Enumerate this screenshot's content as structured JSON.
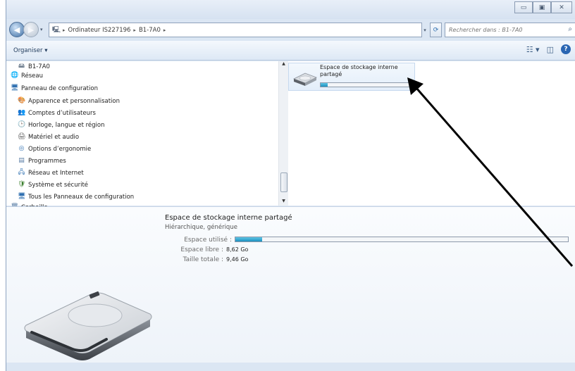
{
  "window": {
    "controls": {
      "minimize": "▭",
      "maximize": "▣",
      "close": "✕"
    }
  },
  "address": {
    "crumbs": [
      "Ordinateur IS227196",
      "B1-7A0"
    ],
    "separator": "▸",
    "refresh_icon": "⟳",
    "search_placeholder": "Rechercher dans : B1-7A0",
    "search_icon": "⌕"
  },
  "toolbar": {
    "organiser_label": "Organiser ▾",
    "view_icon": "☷ ▾",
    "preview_icon": "◫",
    "help_icon": "?"
  },
  "navigation": {
    "items": [
      {
        "label": "B1-7A0",
        "icon": "drive-icon",
        "glyph": "🖴"
      },
      {
        "label": "Réseau",
        "icon": "network-icon",
        "glyph": "🌐"
      },
      {
        "label": "Panneau de configuration",
        "icon": "control-panel-icon",
        "glyph": "🖥"
      },
      {
        "label": "Apparence et personnalisation",
        "icon": "appearance-icon",
        "glyph": "🎨"
      },
      {
        "label": "Comptes d’utilisateurs",
        "icon": "users-icon",
        "glyph": "👥"
      },
      {
        "label": "Horloge, langue et région",
        "icon": "clock-icon",
        "glyph": "🕒"
      },
      {
        "label": "Matériel et audio",
        "icon": "hardware-icon",
        "glyph": "🖨"
      },
      {
        "label": "Options d’ergonomie",
        "icon": "accessibility-icon",
        "glyph": "◎"
      },
      {
        "label": "Programmes",
        "icon": "programs-icon",
        "glyph": "▤"
      },
      {
        "label": "Réseau et Internet",
        "icon": "network-internet-icon",
        "glyph": "🖧"
      },
      {
        "label": "Système et sécurité",
        "icon": "security-icon",
        "glyph": "🛡"
      },
      {
        "label": "Tous les Panneaux de configuration",
        "icon": "all-panels-icon",
        "glyph": "🖥"
      },
      {
        "label": "Corbeille",
        "icon": "recycle-bin-icon",
        "glyph": "🗑"
      }
    ],
    "scroll_up": "▲",
    "scroll_down": "▼"
  },
  "content": {
    "tile_name": "Espace de stockage interne partagé",
    "used_fraction": 0.08
  },
  "details": {
    "title": "Espace de stockage interne partagé",
    "subtitle": "Hiérarchique, générique",
    "used_label": "Espace utilisé :",
    "used_fraction": 0.08,
    "free_label": "Espace libre :",
    "free_value": "8,62 Go",
    "total_label": "Taille totale :",
    "total_value": "9,46 Go"
  },
  "colors": {
    "accent": "#1c8fbf",
    "frame": "#dbe6f3",
    "arrow": "#000000"
  }
}
